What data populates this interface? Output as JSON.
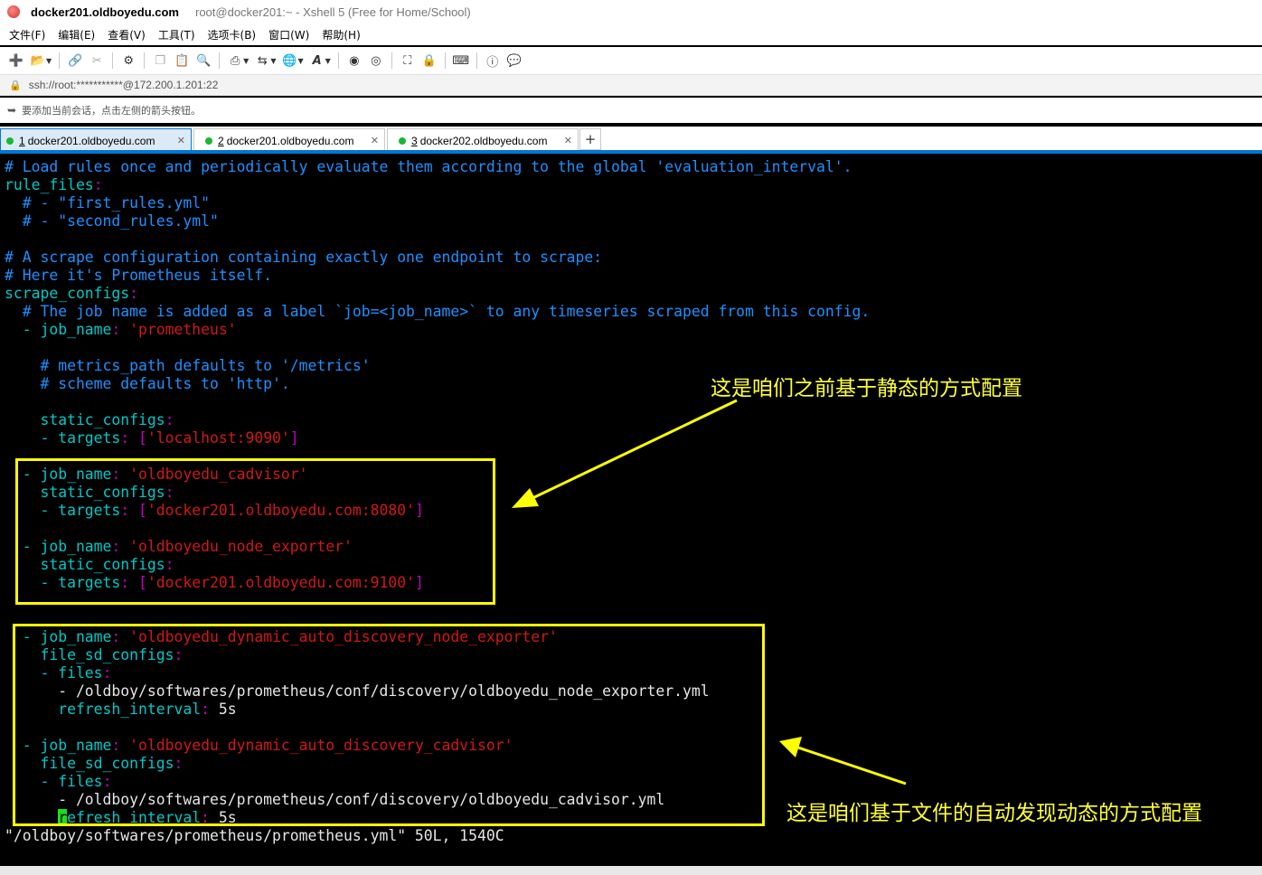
{
  "window": {
    "title": "docker201.oldboyedu.com",
    "subtitle": "root@docker201:~ - Xshell 5 (Free for Home/School)"
  },
  "menu": [
    "文件(F)",
    "编辑(E)",
    "查看(V)",
    "工具(T)",
    "选项卡(B)",
    "窗口(W)",
    "帮助(H)"
  ],
  "address": "ssh://root:***********@172.200.1.201:22",
  "hint": "要添加当前会话，点击左侧的箭头按钮。",
  "tabs": [
    {
      "num": "1",
      "label": "docker201.oldboyedu.com",
      "active": true
    },
    {
      "num": "2",
      "label": "docker201.oldboyedu.com",
      "active": false
    },
    {
      "num": "3",
      "label": "docker202.oldboyedu.com",
      "active": false
    }
  ],
  "add_tab": "+",
  "terminal": {
    "lines": {
      "l1": "# Load rules once and periodically evaluate them according to the global 'evaluation_interval'.",
      "l2": "rule_files",
      "l3": "  # - \"first_rules.yml\"",
      "l4": "  # - \"second_rules.yml\"",
      "l5": "# A scrape configuration containing exactly one endpoint to scrape:",
      "l6": "# Here it's Prometheus itself.",
      "l7": "scrape_configs",
      "l8": "  # The job name is added as a label `job=<job_name>` to any timeseries scraped from this config.",
      "l9_key": "  - job_name",
      "l9_val": "'prometheus'",
      "l10": "    # metrics_path defaults to '/metrics'",
      "l11": "    # scheme defaults to 'http'.",
      "l12": "    static_configs",
      "l13_key": "    - targets",
      "l13_val": "'localhost:9090'",
      "l14_key": "  - job_name",
      "l14_val": "'oldboyedu_cadvisor'",
      "l15": "    static_configs",
      "l16_key": "    - targets",
      "l16_val": "'docker201.oldboyedu.com:8080'",
      "l17_key": "  - job_name",
      "l17_val": "'oldboyedu_node_exporter'",
      "l18": "    static_configs",
      "l19_key": "    - targets",
      "l19_val": "'docker201.oldboyedu.com:9100'",
      "l20_key": "  - job_name",
      "l20_val": "'oldboyedu_dynamic_auto_discovery_node_exporter'",
      "l21": "    file_sd_configs",
      "l22": "    - files",
      "l23": "      - /oldboy/softwares/prometheus/conf/discovery/oldboyedu_node_exporter.yml",
      "l24_key": "      refresh_interval",
      "l24_val": "5s",
      "l25_key": "  - job_name",
      "l25_val": "'oldboyedu_dynamic_auto_discovery_cadvisor'",
      "l26": "    file_sd_configs",
      "l27": "    - files",
      "l28": "      - /oldboy/softwares/prometheus/conf/discovery/oldboyedu_cadvisor.yml",
      "l29_cursor": "r",
      "l29_key": "efresh_interval",
      "l29_val": "5s",
      "status": "\"/oldboy/softwares/prometheus/prometheus.yml\" 50L, 1540C"
    }
  },
  "annotations": {
    "static_note": "这是咱们之前基于静态的方式配置",
    "dynamic_note": "这是咱们基于文件的自动发现动态的方式配置",
    "color": "#ffff00"
  },
  "colors": {
    "comment": "#1e90ff",
    "key": "#00c8c8",
    "string": "#d01818",
    "punct": "#c000c0",
    "accent": "#0078d7"
  }
}
